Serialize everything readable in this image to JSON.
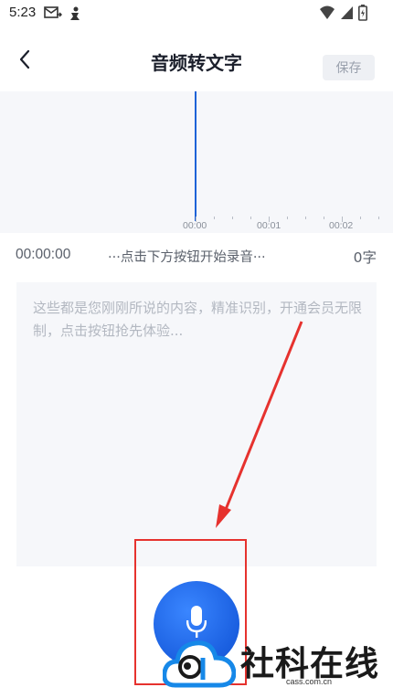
{
  "status_bar": {
    "time": "5:23"
  },
  "header": {
    "title": "音频转文字",
    "save_label": "保存",
    "back_icon": "chevron-left-icon"
  },
  "waveform": {
    "playhead_color": "#1e63d7",
    "timeline_labels": [
      "00:00",
      "00:01",
      "00:02"
    ]
  },
  "info": {
    "elapsed": "00:00:00",
    "status_hint": "···点击下方按钮开始录音···",
    "char_count": "0字"
  },
  "transcript": {
    "placeholder": "这些都是您刚刚所说的内容，精准识别，开通会员无限制，点击按钮抢先体验..."
  },
  "record": {
    "icon": "microphone-icon",
    "color": "#1a5fe0"
  },
  "watermark": {
    "text": "社科在线",
    "url": "cass.com.cn"
  },
  "annotation": {
    "color": "#e6322e"
  }
}
